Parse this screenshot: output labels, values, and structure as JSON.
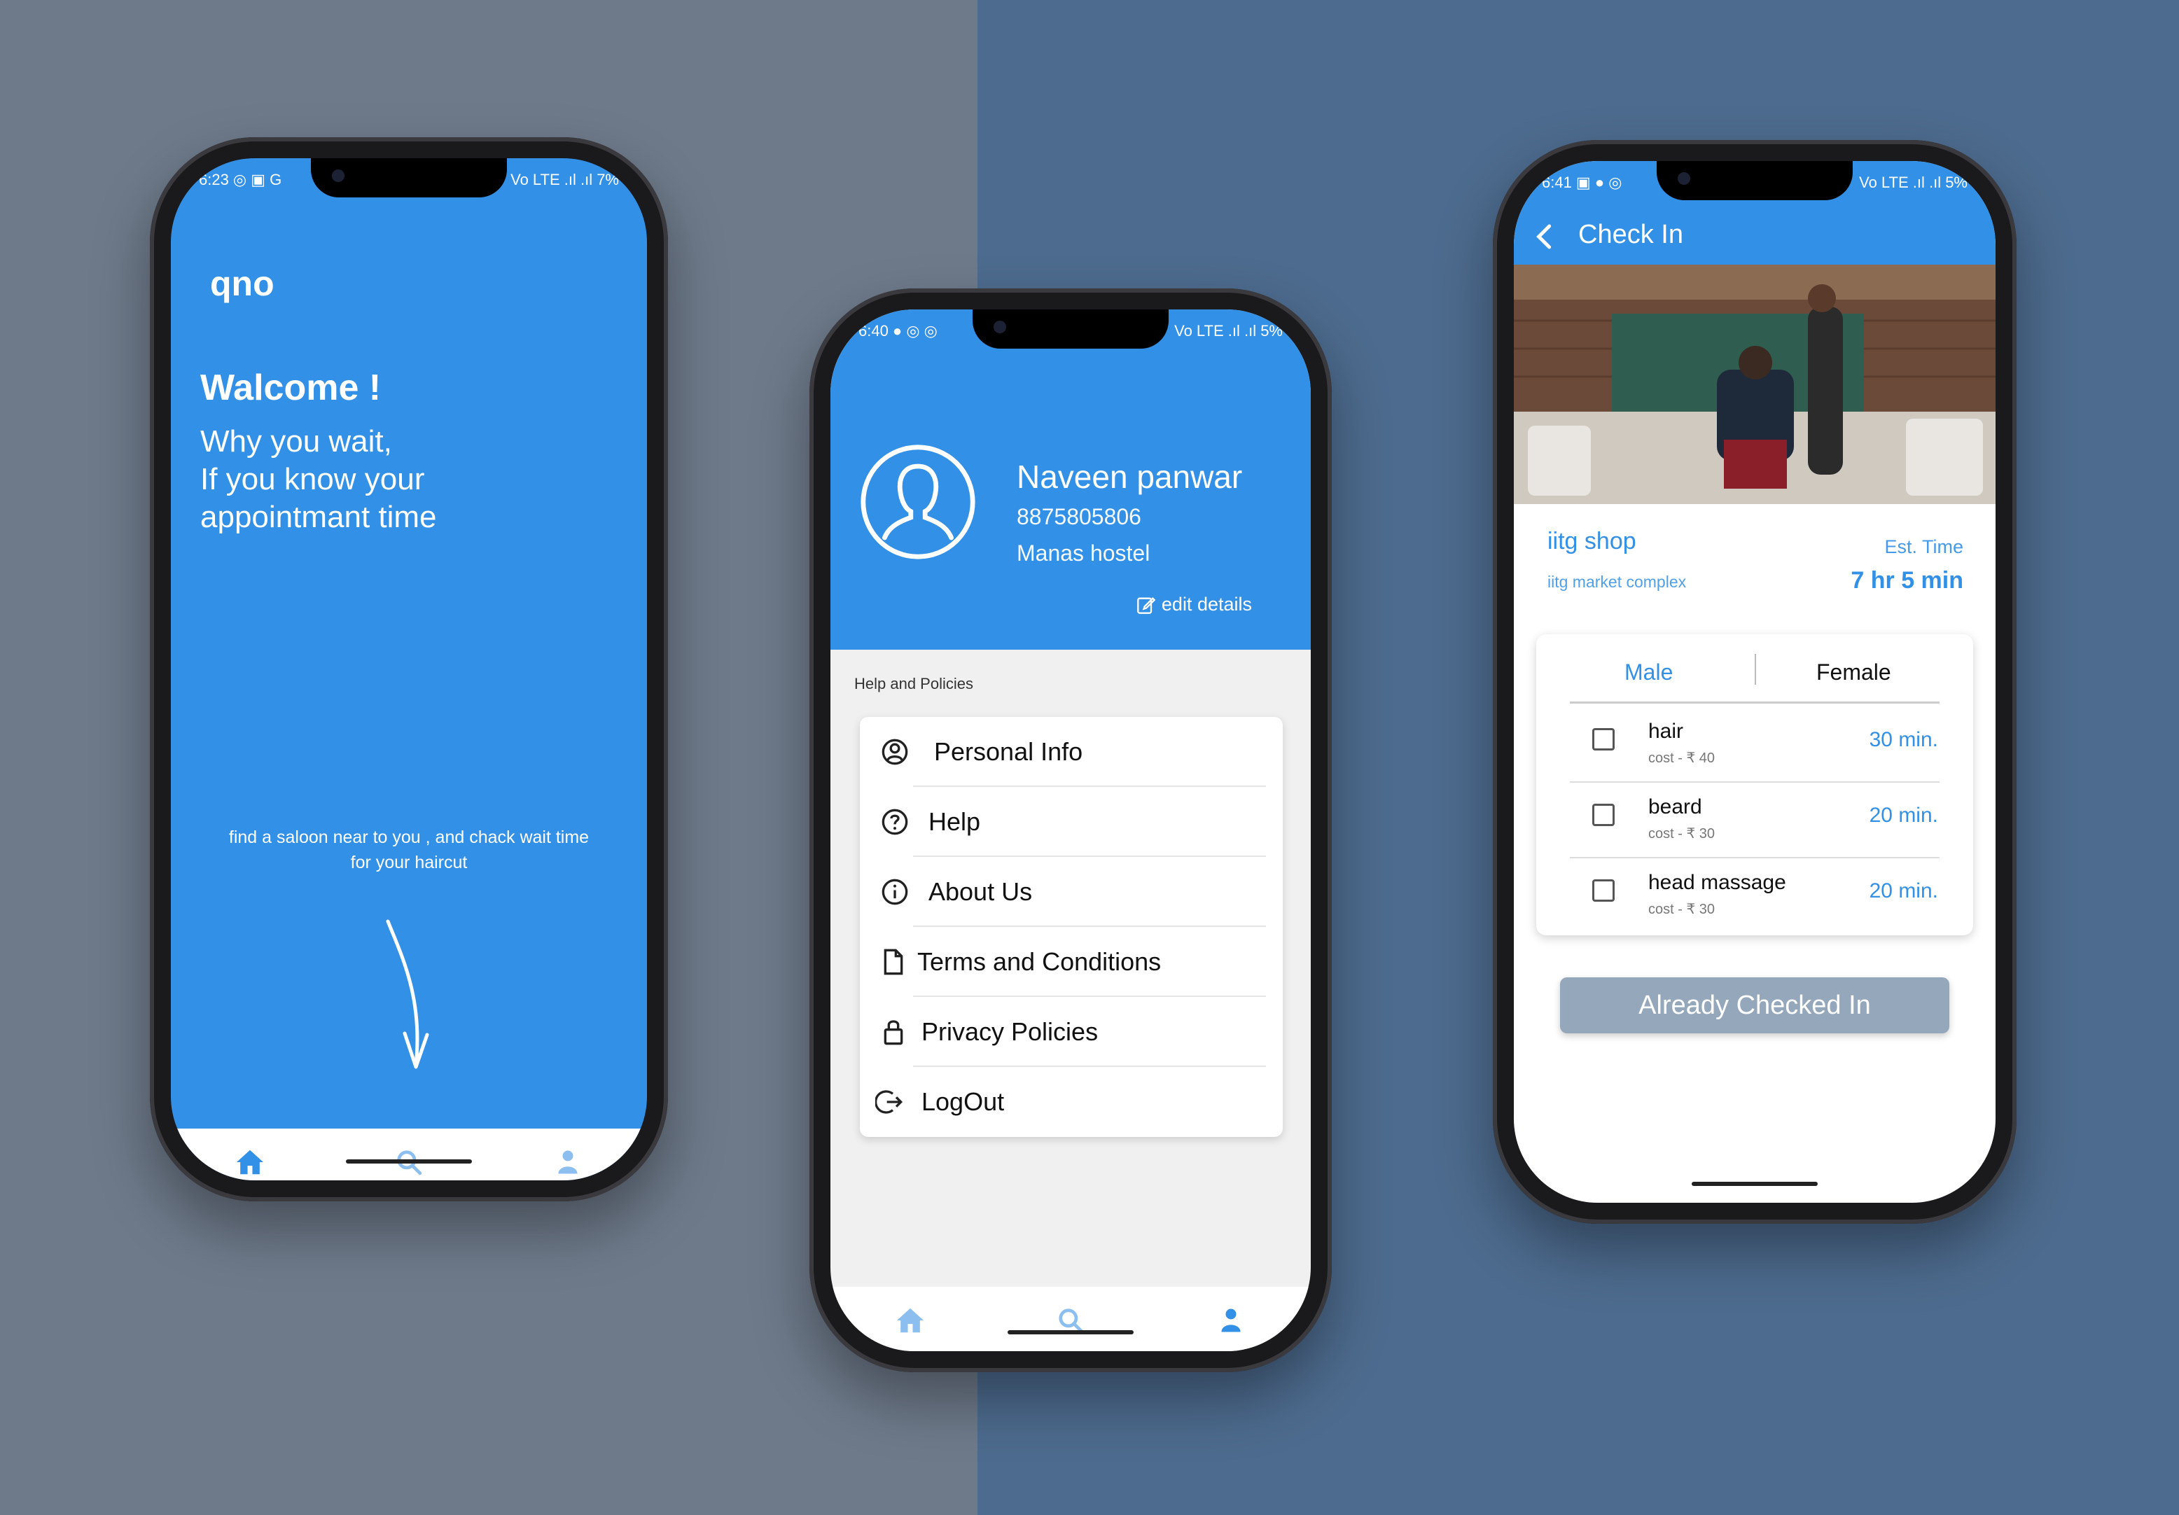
{
  "colors": {
    "primary": "#3290e6",
    "bg_left": "#6e7a8a",
    "bg_right": "#4d6b8e",
    "button_disabled": "#95a7ba"
  },
  "phone1": {
    "status_left": "6:23 ◎ ▣ G",
    "status_right": "Vo LTE .ıl .ıl 7%",
    "logo": "qno",
    "welcome": "Walcome !",
    "tagline": "Why you wait,\nIf you know your\nappointmant time",
    "hint": "find a saloon near to you , and chack wait time for your haircut",
    "nav": [
      {
        "icon": "home-icon",
        "active": true
      },
      {
        "icon": "search-icon",
        "active": false
      },
      {
        "icon": "user-icon",
        "active": false
      }
    ]
  },
  "phone2": {
    "status_left": "6:40 ● ◎ ◎",
    "status_right": "Vo LTE .ıl .ıl 5%",
    "profile": {
      "name": "Naveen panwar",
      "phone": "8875805806",
      "address": "Manas hostel",
      "edit_label": "edit details"
    },
    "section_title": "Help and Policies",
    "menu": [
      {
        "label": "Personal Info",
        "icon": "user-circle-icon"
      },
      {
        "label": "Help",
        "icon": "help-icon"
      },
      {
        "label": "About Us",
        "icon": "info-icon"
      },
      {
        "label": "Terms and Conditions",
        "icon": "document-icon"
      },
      {
        "label": "Privacy Policies",
        "icon": "lock-icon"
      },
      {
        "label": "LogOut",
        "icon": "logout-icon"
      }
    ],
    "nav": [
      {
        "icon": "home-icon",
        "active": false
      },
      {
        "icon": "search-icon",
        "active": false
      },
      {
        "icon": "user-icon",
        "active": true
      }
    ]
  },
  "phone3": {
    "status_left": "6:41 ▣ ● ◎",
    "status_right": "Vo LTE .ıl .ıl 5%",
    "title": "Check In",
    "shop": {
      "name": "iitg shop",
      "address": "iitg market complex",
      "est_label": "Est. Time",
      "est_value": "7 hr 5 min"
    },
    "gender_tabs": [
      "Male",
      "Female"
    ],
    "services": [
      {
        "name": "hair",
        "cost": "cost - ₹ 40",
        "time": "30 min."
      },
      {
        "name": "beard",
        "cost": "cost - ₹ 30",
        "time": "20 min."
      },
      {
        "name": "head massage",
        "cost": "cost - ₹ 30",
        "time": "20 min."
      }
    ],
    "button_label": "Already Checked In"
  }
}
